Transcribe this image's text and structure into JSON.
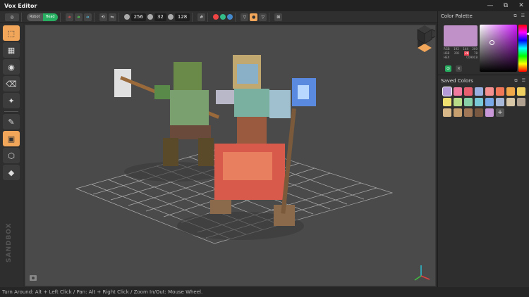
{
  "app": {
    "title": "Vox Editor",
    "window_buttons": [
      "—",
      "⧉",
      "✕"
    ]
  },
  "toolbar": {
    "mode_left": "Robot",
    "mode_right": "Head",
    "dims": [
      "256",
      "32",
      "128"
    ]
  },
  "tools": [
    {
      "name": "select-tool",
      "icon": "⬚"
    },
    {
      "name": "blocks-tool",
      "icon": "▦"
    },
    {
      "name": "palette-tool",
      "icon": "◉"
    },
    {
      "name": "eraser-tool",
      "icon": "⌫"
    },
    {
      "name": "wand-tool",
      "icon": "✦"
    },
    {
      "name": "pencil-tool",
      "icon": "✎"
    },
    {
      "name": "cube-tool",
      "icon": "▣"
    },
    {
      "name": "wire-cube-tool",
      "icon": "⬡"
    },
    {
      "name": "fill-tool",
      "icon": "◆"
    }
  ],
  "brand": "SANDBOX",
  "status": {
    "text": "Turn Around: Alt + Left Click / Pan: Alt + Right Click / Zoom In/Out: Mouse Wheel."
  },
  "color_palette": {
    "title": "Color Palette",
    "current_color": "#c090c8",
    "rows": [
      {
        "label": "RGB",
        "values": [
          "192",
          "144",
          "200"
        ]
      },
      {
        "label": "HSB",
        "values": [
          "291",
          "28",
          "78"
        ]
      },
      {
        "label": "HEX",
        "values": [
          "C090C8"
        ]
      }
    ]
  },
  "saved_colors": {
    "title": "Saved Colors",
    "add_label": "+",
    "swatches": [
      "#b59bd8",
      "#f07aa0",
      "#e86070",
      "#9ab0e0",
      "#f59090",
      "#f07858",
      "#f0a848",
      "#f0d060",
      "#f0e070",
      "#b8dc88",
      "#88d0a8",
      "#78c8d8",
      "#78a8e8",
      "#a8b8d8",
      "#d8c8a8",
      "#b0a090",
      "#d8b888",
      "#c8a070",
      "#a07858",
      "#785840",
      "#c898d8"
    ]
  }
}
